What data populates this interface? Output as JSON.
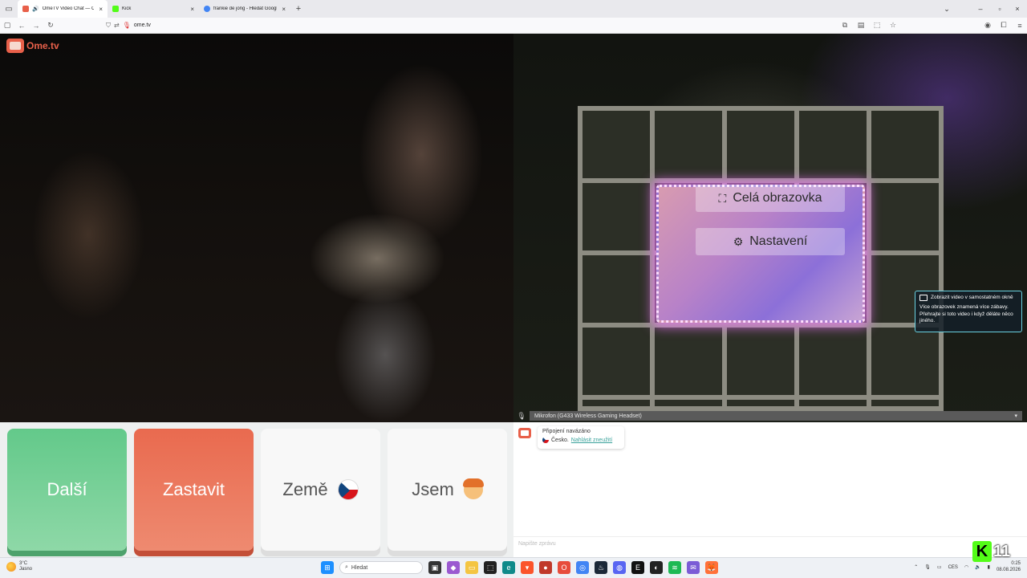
{
  "browser": {
    "tabs": [
      {
        "title": "OmeTV Video Chat — Omegle",
        "active": true,
        "color": "#e8604a"
      },
      {
        "title": "Kick",
        "active": false,
        "color": "#53fc18"
      },
      {
        "title": "frankie de jong - Hledat Googlem",
        "active": false,
        "color": "#4285f4"
      }
    ],
    "url": "ome.tv"
  },
  "site": {
    "logo_text": "Ome.tv"
  },
  "video_overlay": {
    "fullscreen_label": "Celá obrazovka",
    "settings_label": "Nastavení"
  },
  "tooltip": {
    "title": "Zobrazit video v samostatném okně",
    "body": "Více obrazovek znamená více zábavy. Přehrajte si toto video i když děláte něco jiného."
  },
  "mic": {
    "selected": "Mikrofon (G433 Wireless Gaming Headset)"
  },
  "buttons": {
    "next": "Další",
    "stop": "Zastavit",
    "country": "Země",
    "gender": "Jsem"
  },
  "chat": {
    "status": "Připojení navázáno",
    "country": "Česko.",
    "report_link": "Nahlásit zneužití",
    "input_placeholder": "Napište zprávu"
  },
  "overlay_badge": {
    "number": "11"
  },
  "taskbar": {
    "weather_temp": "3°C",
    "weather_desc": "Jasno",
    "search_placeholder": "Hledat",
    "lang": "CES",
    "time": "0:25",
    "date": "08.08.2026"
  },
  "colors": {
    "brand": "#e8604a",
    "next_green": "#63c98a",
    "stop_red": "#e96a4f",
    "link_teal": "#3aa29b"
  }
}
